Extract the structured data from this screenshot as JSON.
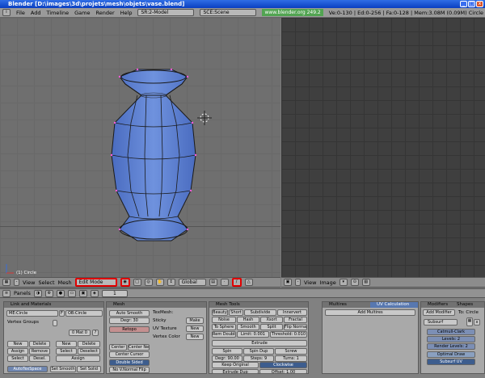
{
  "window": {
    "title": "Blender [D:\\images\\3d\\projets\\mesh\\objets\\vase.blend]"
  },
  "menu": {
    "items": [
      "File",
      "Add",
      "Timeline",
      "Game",
      "Render",
      "Help"
    ],
    "screen": "SR:2-Model",
    "scene": "SCE:Scene",
    "site": "www.blender.org 249.2",
    "stats": "Ve:0-130 | Ed:0-256 | Fa:0-128 | Mem:3.08M (0.09M) Circle"
  },
  "viewport": {
    "object_label": "(1) Circle"
  },
  "view_header": {
    "view": "View",
    "select": "Select",
    "mesh": "Mesh",
    "mode": "Edit Mode",
    "orientation": "Global"
  },
  "image_header": {
    "view": "View",
    "image": "Image"
  },
  "panels_header": {
    "label": "Panels",
    "frame": "1"
  },
  "link_materials": {
    "title": "Link and Materials",
    "me": "ME:Circle",
    "f": "F",
    "ob": "OB:Circle",
    "vertex_groups": "Vertex Groups",
    "mat": "0 Mat 0",
    "btn_new": "New",
    "btn_delete": "Delete",
    "btn_assign": "Assign",
    "btn_remove": "Remove",
    "btn_select": "Select",
    "btn_desel": "Desel.",
    "btn_deselect": "Deselect",
    "autotex": "AutoTexSpace",
    "set_smooth": "Set Smooth",
    "set_solid": "Set Solid"
  },
  "mesh": {
    "title": "Mesh",
    "auto_smooth": "Auto Smooth",
    "degr": "Degr: 30",
    "retopo": "Retopo",
    "center": "Center",
    "center_new": "Center New",
    "center_cursor": "Center Cursor",
    "double_sided": "Double Sided",
    "no_vnormal": "No V.Normal Flip",
    "texmesh": "TexMesh:",
    "sticky": "Sticky",
    "uv_texture": "UV Texture",
    "vertex_color": "Vertex Color",
    "make": "Make",
    "new": "New"
  },
  "mesh_tools": {
    "title": "Mesh Tools",
    "row1": [
      "Beauty",
      "Short",
      "Subdivide",
      "Innervert"
    ],
    "row2": [
      "Noise",
      "Hash",
      "Xsort",
      "Fractal"
    ],
    "row3": [
      "To Sphere",
      "Smooth",
      "Split",
      "Flip Normals"
    ],
    "row4": [
      "Rem Double",
      "Limit: 0.001",
      "Threshold: 0.010"
    ],
    "extrude": "Extrude",
    "row5": [
      "Spin",
      "Spin Dup",
      "Screw"
    ],
    "row6": [
      "Degr: 90.00",
      "Steps: 9",
      "Turns: 1"
    ],
    "keep_original": "Keep Original",
    "clockwise": "Clockwise",
    "extrude_dup": "Extrude Dup",
    "offset": "Offset: 1.00"
  },
  "multires": {
    "title": "Multires",
    "add": "Add Multires"
  },
  "uv_calc": {
    "title": "UV Calculation"
  },
  "modifiers": {
    "tab1": "Modifiers",
    "tab2": "Shapes",
    "add": "Add Modifier",
    "to": "To: Circle",
    "name": "Subsurf",
    "type": "Catmull-Clark",
    "levels": "Levels: 2",
    "render_levels": "Render Levels: 2",
    "optimal": "Optimal Draw",
    "subsurf_uv": "Subsurf UV"
  },
  "colors": {
    "mesh_face": "#5b7fd0",
    "mesh_edge": "#1a1a1a",
    "highlight": "#e00000",
    "title_blue": "#1b55d8"
  }
}
